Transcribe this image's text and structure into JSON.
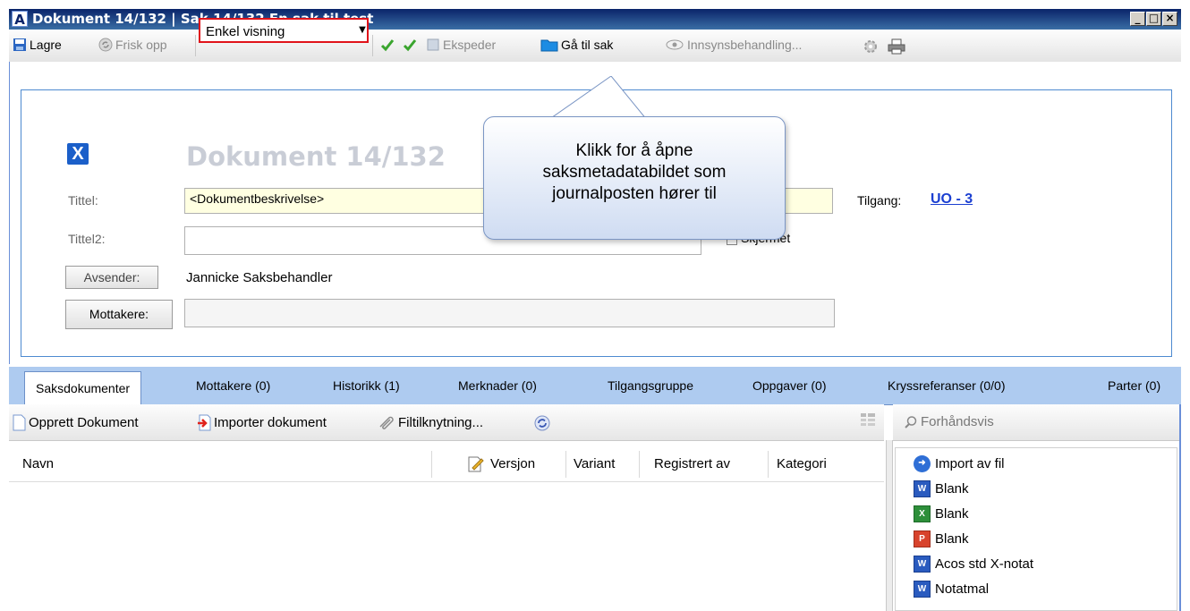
{
  "window": {
    "title": "Dokument 14/132 | Sak 14/132 En sak til test",
    "app_icon": "A"
  },
  "toolbar": {
    "save_label": "Lagre",
    "refresh_label": "Frisk opp",
    "view_select_value": "Enkel visning",
    "expedite_label": "Ekspeder",
    "goto_case_label": "Gå til sak",
    "access_label": "Innsynsbehandling..."
  },
  "document": {
    "heading": "Dokument 14/132",
    "title_label": "Tittel:",
    "title_value": "<Dokumentbeskrivelse>",
    "title2_label": "Tittel2:",
    "title2_value": "",
    "shielded_label": "Skjermet",
    "access_label": "Tilgang:",
    "access_value": "UO - 3",
    "sender_button": "Avsender:",
    "sender_value": "Jannicke Saksbehandler",
    "recipients_button": "Mottakere:",
    "recipients_value": ""
  },
  "callout": {
    "text": "Klikk for å åpne saksmetadatabildet som journalposten hører til"
  },
  "tabs": [
    {
      "label": "Saksdokumenter",
      "active": true
    },
    {
      "label": "Mottakere (0)"
    },
    {
      "label": "Historikk (1)"
    },
    {
      "label": "Merknader (0)"
    },
    {
      "label": "Tilgangsgruppe"
    },
    {
      "label": "Oppgaver (0)"
    },
    {
      "label": "Kryssreferanser (0/0)"
    },
    {
      "label": "Parter (0)"
    }
  ],
  "doc_toolbar": {
    "create_label": "Opprett Dokument",
    "import_label": "Importer dokument",
    "attach_label": "Filtilknytning..."
  },
  "preview": {
    "label": "Forhåndsvis"
  },
  "list": {
    "columns": [
      "Navn",
      "Versjon",
      "Variant",
      "Registrert av",
      "Kategori"
    ]
  },
  "templates": [
    {
      "label": "Import av fil",
      "icon": "import-icon"
    },
    {
      "label": "Blank",
      "icon": "word-icon"
    },
    {
      "label": "Blank",
      "icon": "excel-icon"
    },
    {
      "label": "Blank",
      "icon": "powerpoint-icon"
    },
    {
      "label": "Acos std X-notat",
      "icon": "word-icon"
    },
    {
      "label": "Notatmal",
      "icon": "word-icon"
    }
  ],
  "colors": {
    "titlebar": "#0a246a",
    "highlight_border": "#e0131a",
    "tab_bar": "#aecbf0",
    "link": "#1b3fd1",
    "title_field_bg": "#ffffe1"
  }
}
